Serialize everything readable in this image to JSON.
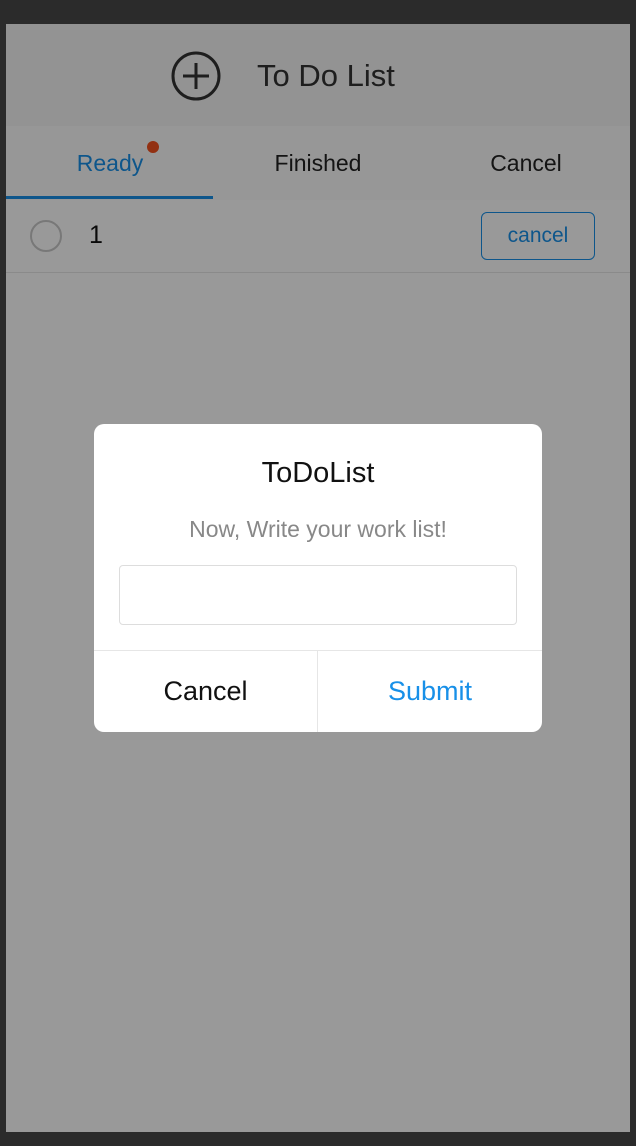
{
  "header": {
    "title": "To Do List",
    "add_icon": "plus-circle-icon"
  },
  "tabs": [
    {
      "label": "Ready",
      "active": true,
      "has_badge_dot": true
    },
    {
      "label": "Finished",
      "active": false
    },
    {
      "label": "Cancel",
      "active": false
    }
  ],
  "todos": [
    {
      "text": "1",
      "action_label": "cancel",
      "checked": false
    }
  ],
  "dialog": {
    "title": "ToDoList",
    "message": "Now, Write your work list!",
    "input_value": "",
    "input_placeholder": "",
    "cancel_label": "Cancel",
    "submit_label": "Submit"
  },
  "colors": {
    "accent": "#1890e8",
    "badge": "#f4511e",
    "overlay": "rgba(0,0,0,0.4)"
  }
}
